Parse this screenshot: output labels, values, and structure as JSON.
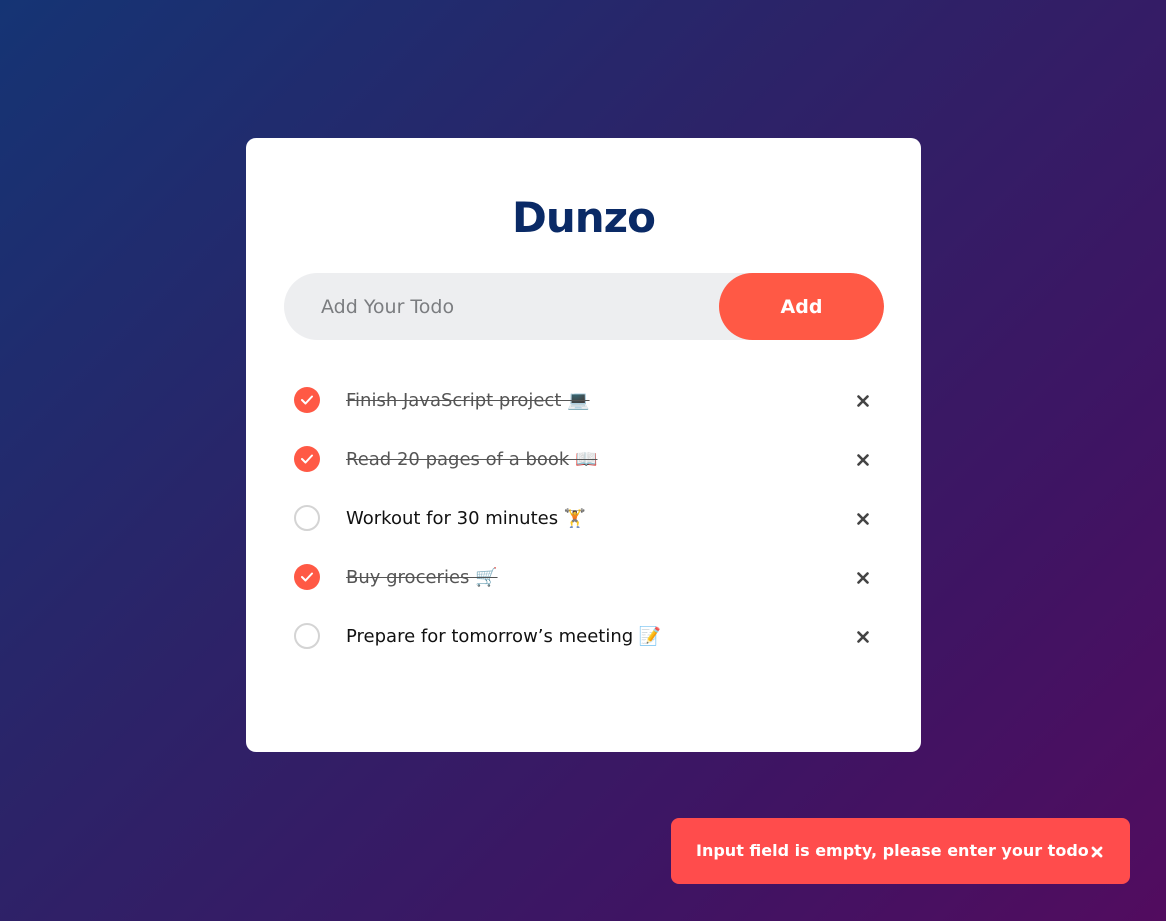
{
  "app": {
    "title": "Dunzo"
  },
  "input": {
    "placeholder": "Add Your Todo",
    "value": ""
  },
  "add_button": {
    "label": "Add"
  },
  "todos": [
    {
      "text": "Finish JavaScript project 💻",
      "done": true
    },
    {
      "text": "Read 20 pages of a book 📖",
      "done": true
    },
    {
      "text": "Workout for 30 minutes 🏋️",
      "done": false
    },
    {
      "text": "Buy groceries 🛒",
      "done": true
    },
    {
      "text": "Prepare for tomorrow’s meeting 📝",
      "done": false
    }
  ],
  "toast": {
    "message": "Input field is empty, please enter your todo"
  },
  "icons": {
    "check": "check-icon",
    "delete": "close-icon",
    "toast_close": "close-icon"
  },
  "colors": {
    "accent": "#ff5945",
    "title": "#0a2a66",
    "toast": "#ff4c4c"
  }
}
